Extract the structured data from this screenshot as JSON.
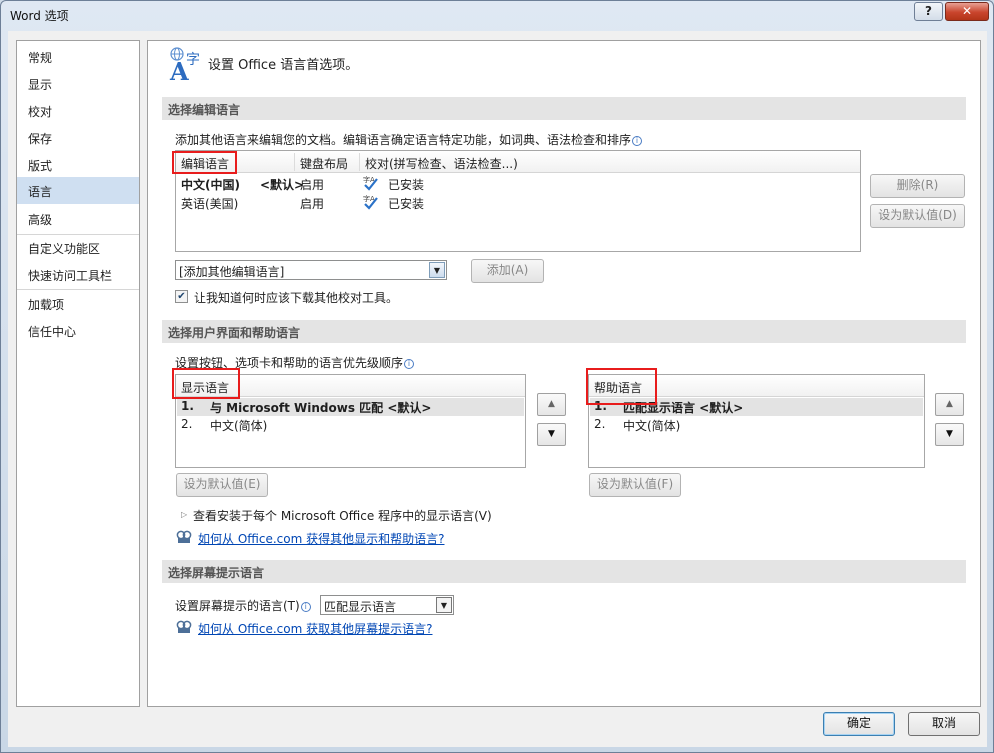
{
  "window": {
    "title": "Word 选项",
    "help_label": "?",
    "close_label": "✕"
  },
  "nav": {
    "items": [
      {
        "label": "常规"
      },
      {
        "label": "显示"
      },
      {
        "label": "校对"
      },
      {
        "label": "保存"
      },
      {
        "label": "版式"
      },
      {
        "label": "语言"
      },
      {
        "label": "高级"
      },
      {
        "label": "自定义功能区"
      },
      {
        "label": "快速访问工具栏"
      },
      {
        "label": "加载项"
      },
      {
        "label": "信任中心"
      }
    ],
    "selected": "语言"
  },
  "header": {
    "title": "设置 Office 语言首选项。",
    "icon": "language-settings-icon",
    "icon_glyph_a": "A",
    "icon_glyph_zi": "字"
  },
  "editing": {
    "section_title": "选择编辑语言",
    "description": "添加其他语言来编辑您的文档。编辑语言确定语言特定功能，如词典、语法检查和排序",
    "columns": [
      "编辑语言",
      "键盘布局",
      "校对(拼写检查、语法检查...)"
    ],
    "rows": [
      {
        "language": "中文(中国)",
        "default_tag": "<默认>",
        "keyboard": "启用",
        "proofing": "已安装"
      },
      {
        "language": "英语(美国)",
        "default_tag": "",
        "keyboard": "启用",
        "proofing": "已安装"
      }
    ],
    "remove_button": "删除(R)",
    "set_default_button": "设为默认值(D)",
    "add_combo_value": "[添加其他编辑语言]",
    "add_button": "添加(A)",
    "notify_checkbox_label": "让我知道何时应该下载其他校对工具。",
    "notify_checked": true
  },
  "ui_language": {
    "section_title": "选择用户界面和帮助语言",
    "description": "设置按钮、选项卡和帮助的语言优先级顺序",
    "display": {
      "header": "显示语言",
      "items": [
        {
          "num": "1.",
          "label": "与 Microsoft Windows 匹配 <默认>"
        },
        {
          "num": "2.",
          "label": "中文(简体)"
        }
      ],
      "set_default_button": "设为默认值(E)"
    },
    "help": {
      "header": "帮助语言",
      "items": [
        {
          "num": "1.",
          "label": "匹配显示语言 <默认>"
        },
        {
          "num": "2.",
          "label": "中文(简体)"
        }
      ],
      "set_default_button": "设为默认值(F)"
    },
    "view_installed_label": "查看安装于每个 Microsoft Office 程序中的显示语言(V)",
    "link_text": "如何从 Office.com 获得其他显示和帮助语言?"
  },
  "screentip": {
    "section_title": "选择屏幕提示语言",
    "label": "设置屏幕提示的语言(T)",
    "combo_value": "匹配显示语言",
    "link_text": "如何从 Office.com 获取其他屏幕提示语言?"
  },
  "footer": {
    "ok_button": "确定",
    "cancel_button": "取消"
  },
  "colors": {
    "highlight_box": "#e81c1c",
    "selected_nav": "#cfdff1",
    "link": "#0046b4"
  }
}
